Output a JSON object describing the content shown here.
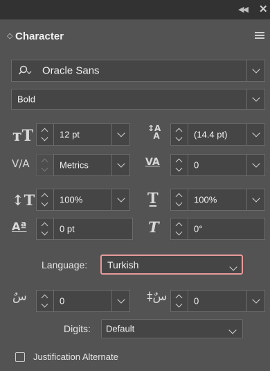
{
  "panel": {
    "tab_title": "Character"
  },
  "font": {
    "family": "Oracle Sans",
    "style": "Bold"
  },
  "size": {
    "value": "12 pt"
  },
  "leading": {
    "value": "(14.4 pt)"
  },
  "kerning": {
    "value": "Metrics"
  },
  "tracking": {
    "value": "0"
  },
  "vscale": {
    "value": "100%"
  },
  "hscale": {
    "value": "100%"
  },
  "baseline": {
    "value": "0 pt"
  },
  "skew": {
    "value": "0°"
  },
  "language": {
    "label": "Language:",
    "value": "Turkish"
  },
  "arabic": {
    "left_value": "0",
    "right_value": "0"
  },
  "digits": {
    "label": "Digits:",
    "value": "Default"
  },
  "justification": {
    "label": "Justification Alternate"
  },
  "icons": {
    "collapse": "double-left-chevron-icon",
    "close": "close-icon",
    "menu": "hamburger-menu-icon",
    "search": "search-icon"
  }
}
